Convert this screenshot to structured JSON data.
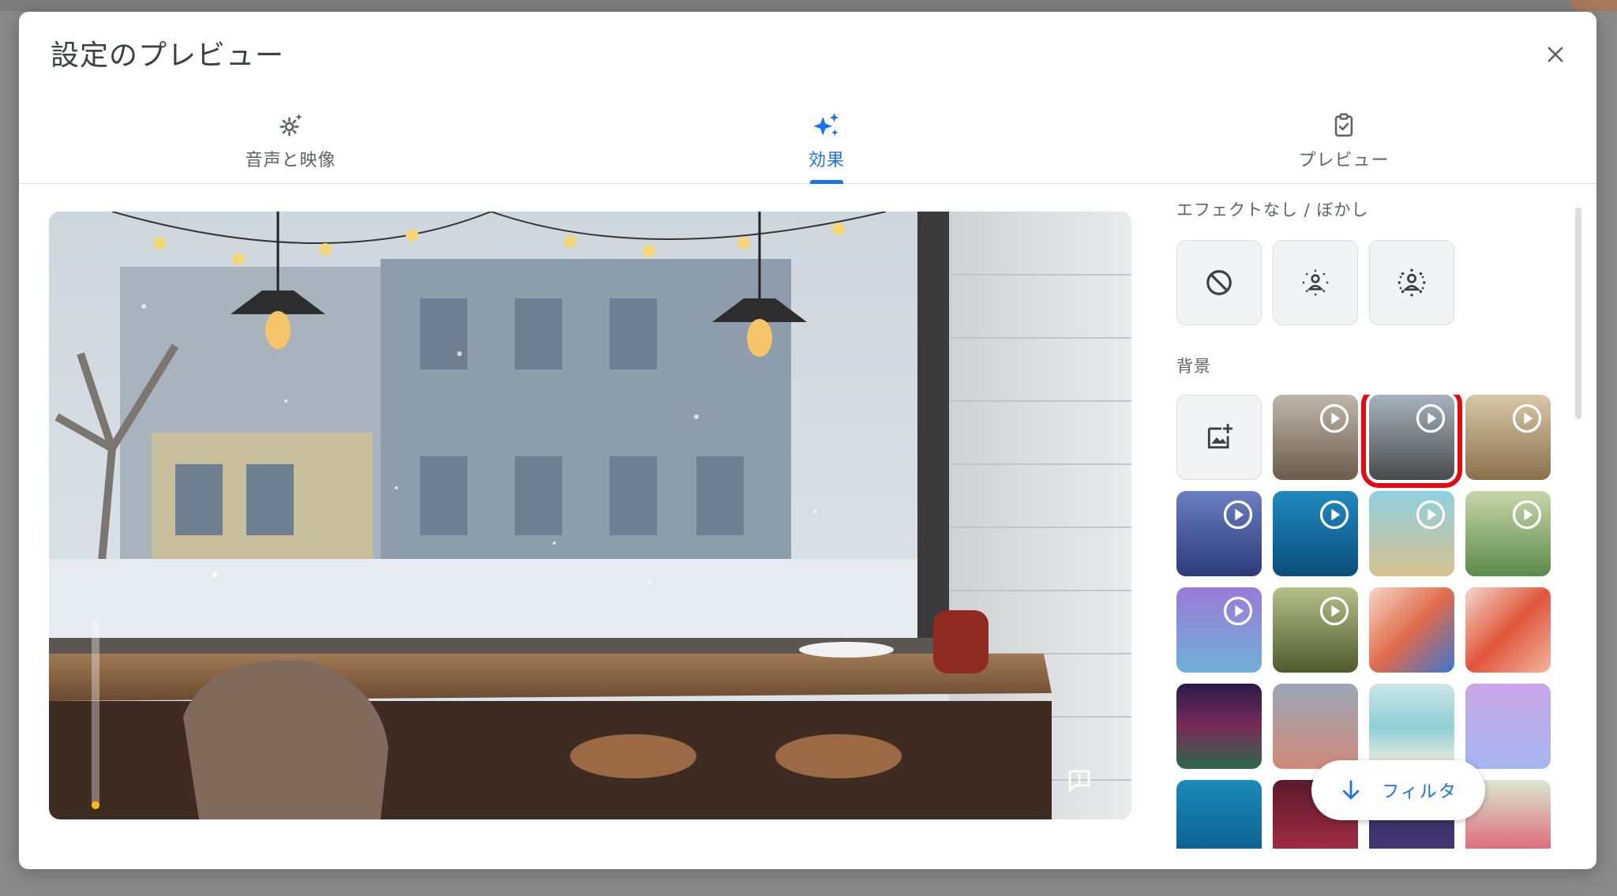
{
  "dialog": {
    "title": "設定のプレビュー"
  },
  "tabs": [
    {
      "label": "音声と映像",
      "icon": "settings-sparkle-icon"
    },
    {
      "label": "効果",
      "icon": "sparkle-icon",
      "active": true
    },
    {
      "label": "プレビュー",
      "icon": "clipboard-check-icon"
    }
  ],
  "effects": {
    "section_label": "エフェクトなし / ぼかし",
    "options": [
      {
        "icon": "no-effect-icon"
      },
      {
        "icon": "slight-blur-icon"
      },
      {
        "icon": "blur-icon"
      }
    ]
  },
  "backgrounds": {
    "section_label": "背景",
    "selected_index": 2
  },
  "filter_button": {
    "label": "フィルタ"
  },
  "colors": {
    "accent": "#1a73e8",
    "selection": "#e50914",
    "level": "#fbbc04"
  }
}
